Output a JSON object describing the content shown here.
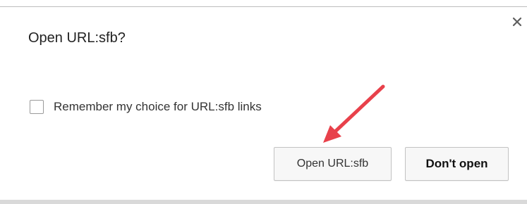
{
  "dialog": {
    "title": "Open URL:sfb?",
    "close_icon": "close-icon",
    "remember_label": "Remember my choice for URL:sfb links",
    "remember_checked": false,
    "buttons": {
      "open_label": "Open URL:sfb",
      "dont_open_label": "Don't open"
    }
  },
  "annotation": {
    "arrow_icon": "red-arrow-annotation",
    "arrow_color": "#e8414b"
  },
  "colors": {
    "background": "#ffffff",
    "button_bg": "#f7f7f7",
    "button_border": "#c3c3c3",
    "text": "#333333"
  }
}
